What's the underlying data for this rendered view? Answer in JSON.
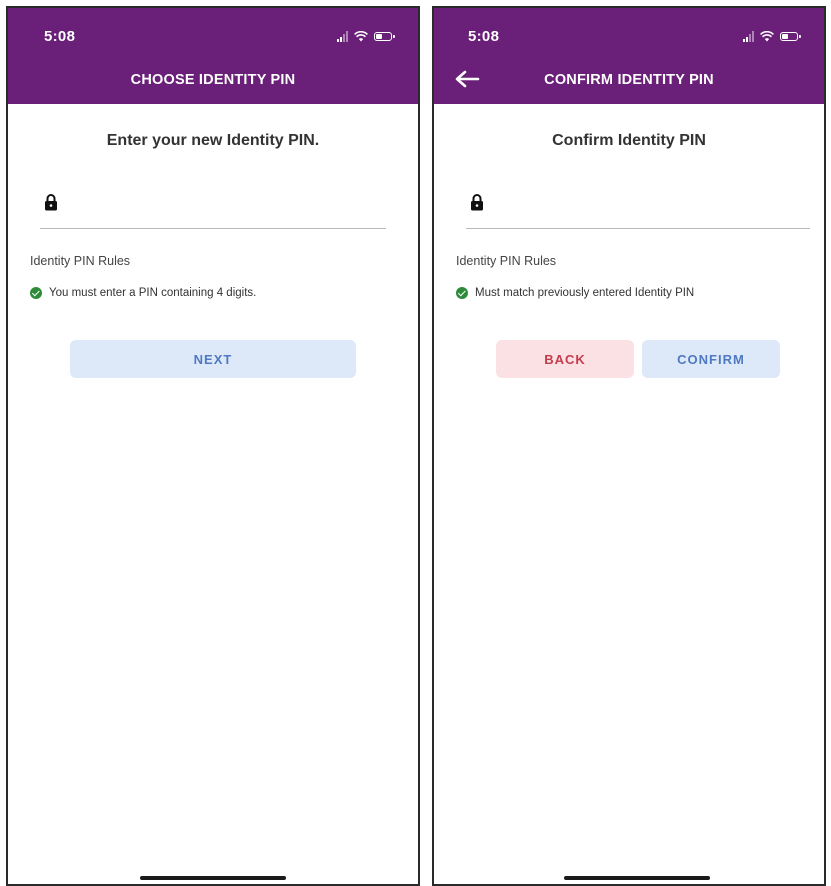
{
  "screens": [
    {
      "status_time": "5:08",
      "title": "CHOOSE IDENTITY PIN",
      "prompt": "Enter your new Identity PIN.",
      "pin_value": "",
      "rules_title": "Identity PIN Rules",
      "rule": "You must enter a PIN containing 4 digits.",
      "buttons": {
        "next": "NEXT"
      }
    },
    {
      "status_time": "5:08",
      "title": "CONFIRM IDENTITY PIN",
      "prompt": "Confirm Identity PIN",
      "pin_value": "",
      "rules_title": "Identity PIN Rules",
      "rule": "Must match previously entered Identity PIN",
      "buttons": {
        "back": "BACK",
        "confirm": "CONFIRM"
      }
    }
  ],
  "icons": {
    "lock": "lock-icon",
    "check": "check-circle-icon",
    "back": "arrow-left-icon",
    "signal": "signal-icon",
    "wifi": "wifi-icon",
    "battery": "battery-icon"
  },
  "colors": {
    "header": "#6a1f78",
    "primary_button_bg": "#dde9f8",
    "primary_button_text": "#4f79c2",
    "back_button_bg": "#fbe1e4",
    "back_button_text": "#c43c4c",
    "rule_check": "#2e8b3a"
  }
}
